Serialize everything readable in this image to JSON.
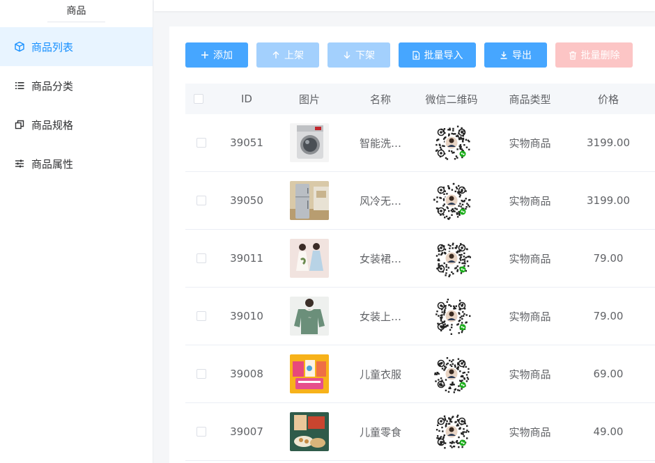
{
  "sidebar": {
    "title": "商品",
    "items": [
      {
        "label": "商品列表",
        "icon": "cube-icon",
        "active": true
      },
      {
        "label": "商品分类",
        "icon": "list-icon",
        "active": false
      },
      {
        "label": "商品规格",
        "icon": "copy-icon",
        "active": false
      },
      {
        "label": "商品属性",
        "icon": "sliders-icon",
        "active": false
      }
    ]
  },
  "toolbar": {
    "add": "添加",
    "on_shelf": "上架",
    "off_shelf": "下架",
    "batch_import": "批量导入",
    "export": "导出",
    "batch_delete": "批量删除"
  },
  "table": {
    "headers": {
      "id": "ID",
      "image": "图片",
      "name": "名称",
      "qr": "微信二维码",
      "type": "商品类型",
      "price": "价格"
    },
    "rows": [
      {
        "id": "39051",
        "name": "智能洗…",
        "type": "实物商品",
        "price": "3199.00",
        "image": "washing-machine"
      },
      {
        "id": "39050",
        "name": "风冷无…",
        "type": "实物商品",
        "price": "3199.00",
        "image": "refrigerator"
      },
      {
        "id": "39011",
        "name": "女装裙…",
        "type": "实物商品",
        "price": "79.00",
        "image": "dress"
      },
      {
        "id": "39010",
        "name": "女装上…",
        "type": "实物商品",
        "price": "79.00",
        "image": "sweater"
      },
      {
        "id": "39008",
        "name": "儿童衣服",
        "type": "实物商品",
        "price": "69.00",
        "image": "kids-clothes"
      },
      {
        "id": "39007",
        "name": "儿童零食",
        "type": "实物商品",
        "price": "49.00",
        "image": "snacks"
      }
    ]
  },
  "colors": {
    "primary": "#46a6ff",
    "primary_light": "#a3d0fd",
    "danger_light": "#fcc5c5",
    "active_bg": "#e8f4ff",
    "active_text": "#1890ff"
  }
}
